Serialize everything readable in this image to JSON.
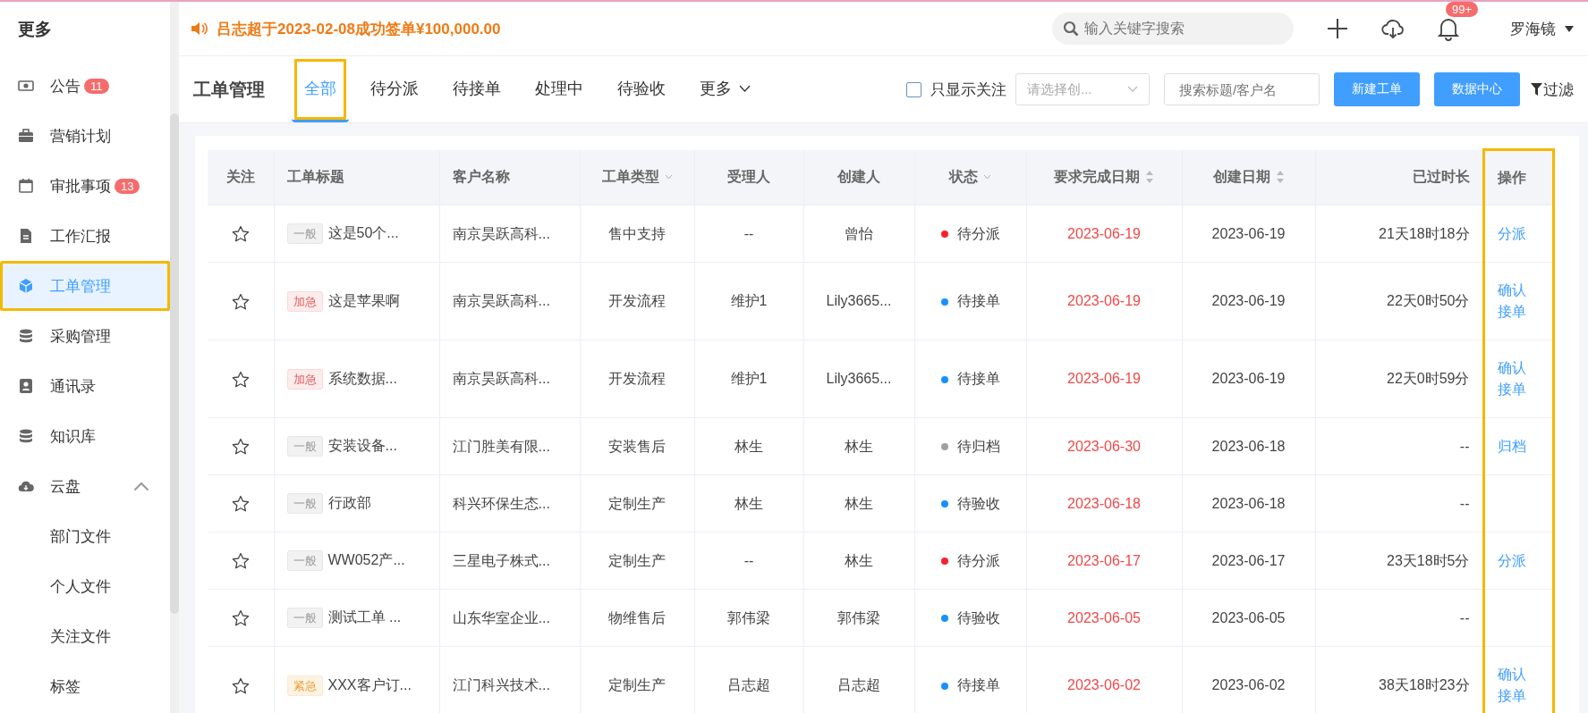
{
  "sidebar": {
    "title": "更多",
    "items": [
      {
        "label": "公告",
        "kind": "money",
        "badge": "11",
        "selected": false,
        "highlighted": false
      },
      {
        "label": "营销计划",
        "kind": "briefcase",
        "selected": false,
        "highlighted": false
      },
      {
        "label": "审批事项",
        "kind": "calendar",
        "badge": "13",
        "selected": false,
        "highlighted": false
      },
      {
        "label": "工作汇报",
        "kind": "document",
        "selected": false,
        "highlighted": false
      },
      {
        "label": "工单管理",
        "kind": "cube",
        "selected": true,
        "highlighted": true
      },
      {
        "label": "采购管理",
        "kind": "database",
        "selected": false,
        "highlighted": false
      },
      {
        "label": "通讯录",
        "kind": "contact",
        "selected": false,
        "highlighted": false
      },
      {
        "label": "知识库",
        "kind": "database",
        "selected": false,
        "highlighted": false
      },
      {
        "label": "云盘",
        "kind": "cloud",
        "selected": false,
        "highlighted": false,
        "expanded": true,
        "children": [
          {
            "label": "部门文件",
            "selected": false
          },
          {
            "label": "个人文件",
            "selected": false
          },
          {
            "label": "关注文件",
            "selected": false
          },
          {
            "label": "标签",
            "selected": false
          }
        ]
      }
    ]
  },
  "topbar": {
    "notice": "吕志超于2023-02-08成功签单¥100,000.00",
    "search": {
      "placeholder": "输入关键字搜索"
    },
    "notification_badge": "99+",
    "user": "罗海镜"
  },
  "page": {
    "title": "工单管理",
    "tabs": [
      {
        "label": "全部",
        "selected": true,
        "highlighted": true
      },
      {
        "label": "待分派",
        "selected": false,
        "highlighted": false
      },
      {
        "label": "待接单",
        "selected": false,
        "highlighted": false
      },
      {
        "label": "处理中",
        "selected": false,
        "highlighted": false
      },
      {
        "label": "待验收",
        "selected": false,
        "highlighted": false
      },
      {
        "label": "更多",
        "selected": false,
        "highlighted": false,
        "dropdown": true
      }
    ],
    "follow_only": {
      "label": "只显示关注",
      "checked": false
    },
    "creator_select": {
      "placeholder": "请选择创..."
    },
    "title_search": {
      "placeholder": "搜索标题/客户名"
    },
    "buttons": [
      "新建工单",
      "数据中心"
    ],
    "filter": "过滤"
  },
  "table": {
    "columns": [
      {
        "label": "关注",
        "kind": "plain",
        "highlighted": false
      },
      {
        "label": "工单标题",
        "kind": "plain",
        "highlighted": false
      },
      {
        "label": "客户名称",
        "kind": "plain",
        "highlighted": false
      },
      {
        "label": "工单类型",
        "kind": "filter",
        "highlighted": false
      },
      {
        "label": "受理人",
        "kind": "plain",
        "highlighted": false
      },
      {
        "label": "创建人",
        "kind": "plain",
        "highlighted": false
      },
      {
        "label": "状态",
        "kind": "filter",
        "highlighted": false
      },
      {
        "label": "要求完成日期",
        "kind": "sort",
        "highlighted": false
      },
      {
        "label": "创建日期",
        "kind": "sort",
        "highlighted": false
      },
      {
        "label": "已过时长",
        "kind": "plain",
        "highlighted": false
      },
      {
        "label": "操作",
        "kind": "plain",
        "highlighted": true
      }
    ],
    "rows": [
      {
        "starred": false,
        "tag": {
          "text": "一般",
          "kind": "normal"
        },
        "title": "这是50个...",
        "customer": "南京昊跃高科...",
        "type": "售中支持",
        "assignee": "--",
        "creator": "曾怡",
        "status": {
          "text": "待分派",
          "color": "#f5222d"
        },
        "due": "2023-06-19",
        "created": "2023-06-19",
        "elapsed": "21天18时18分",
        "actions": [
          "分派"
        ]
      },
      {
        "starred": false,
        "tag": {
          "text": "加急",
          "kind": "urgent"
        },
        "title": "这是苹果啊",
        "customer": "南京昊跃高科...",
        "type": "开发流程",
        "assignee": "维护1",
        "creator": "Lily3665...",
        "status": {
          "text": "待接单",
          "color": "#1890ff"
        },
        "due": "2023-06-19",
        "created": "2023-06-19",
        "elapsed": "22天0时50分",
        "actions": [
          "确认",
          "接单"
        ]
      },
      {
        "starred": false,
        "tag": {
          "text": "加急",
          "kind": "urgent"
        },
        "title": "系统数据...",
        "customer": "南京昊跃高科...",
        "type": "开发流程",
        "assignee": "维护1",
        "creator": "Lily3665...",
        "status": {
          "text": "待接单",
          "color": "#1890ff"
        },
        "due": "2023-06-19",
        "created": "2023-06-19",
        "elapsed": "22天0时59分",
        "actions": [
          "确认",
          "接单"
        ]
      },
      {
        "starred": false,
        "tag": {
          "text": "一般",
          "kind": "normal"
        },
        "title": "安装设备...",
        "customer": "江门胜美有限...",
        "type": "安装售后",
        "assignee": "林生",
        "creator": "林生",
        "status": {
          "text": "待归档",
          "color": "#a0a0a0"
        },
        "due": "2023-06-30",
        "created": "2023-06-18",
        "elapsed": "--",
        "actions": [
          "归档"
        ]
      },
      {
        "starred": false,
        "tag": {
          "text": "一般",
          "kind": "normal"
        },
        "title": "行政部",
        "customer": "科兴环保生态...",
        "type": "定制生产",
        "assignee": "林生",
        "creator": "林生",
        "status": {
          "text": "待验收",
          "color": "#1890ff"
        },
        "due": "2023-06-18",
        "created": "2023-06-18",
        "elapsed": "--",
        "actions": []
      },
      {
        "starred": false,
        "tag": {
          "text": "一般",
          "kind": "normal"
        },
        "title": "WW052产...",
        "customer": "三星电子株式...",
        "type": "定制生产",
        "assignee": "--",
        "creator": "林生",
        "status": {
          "text": "待分派",
          "color": "#f5222d"
        },
        "due": "2023-06-17",
        "created": "2023-06-17",
        "elapsed": "23天18时5分",
        "actions": [
          "分派"
        ]
      },
      {
        "starred": false,
        "tag": {
          "text": "一般",
          "kind": "normal"
        },
        "title": "测试工单 ...",
        "customer": "山东华室企业...",
        "type": "物维售后",
        "assignee": "郭伟梁",
        "creator": "郭伟梁",
        "status": {
          "text": "待验收",
          "color": "#1890ff"
        },
        "due": "2023-06-05",
        "created": "2023-06-05",
        "elapsed": "--",
        "actions": []
      },
      {
        "starred": false,
        "tag": {
          "text": "紧急",
          "kind": "critical"
        },
        "title": "XXX客户订...",
        "customer": "江门科兴技术...",
        "type": "定制生产",
        "assignee": "吕志超",
        "creator": "吕志超",
        "status": {
          "text": "待接单",
          "color": "#1890ff"
        },
        "due": "2023-06-02",
        "created": "2023-06-02",
        "elapsed": "38天18时23分",
        "actions": [
          "确认",
          "接单"
        ]
      }
    ]
  }
}
